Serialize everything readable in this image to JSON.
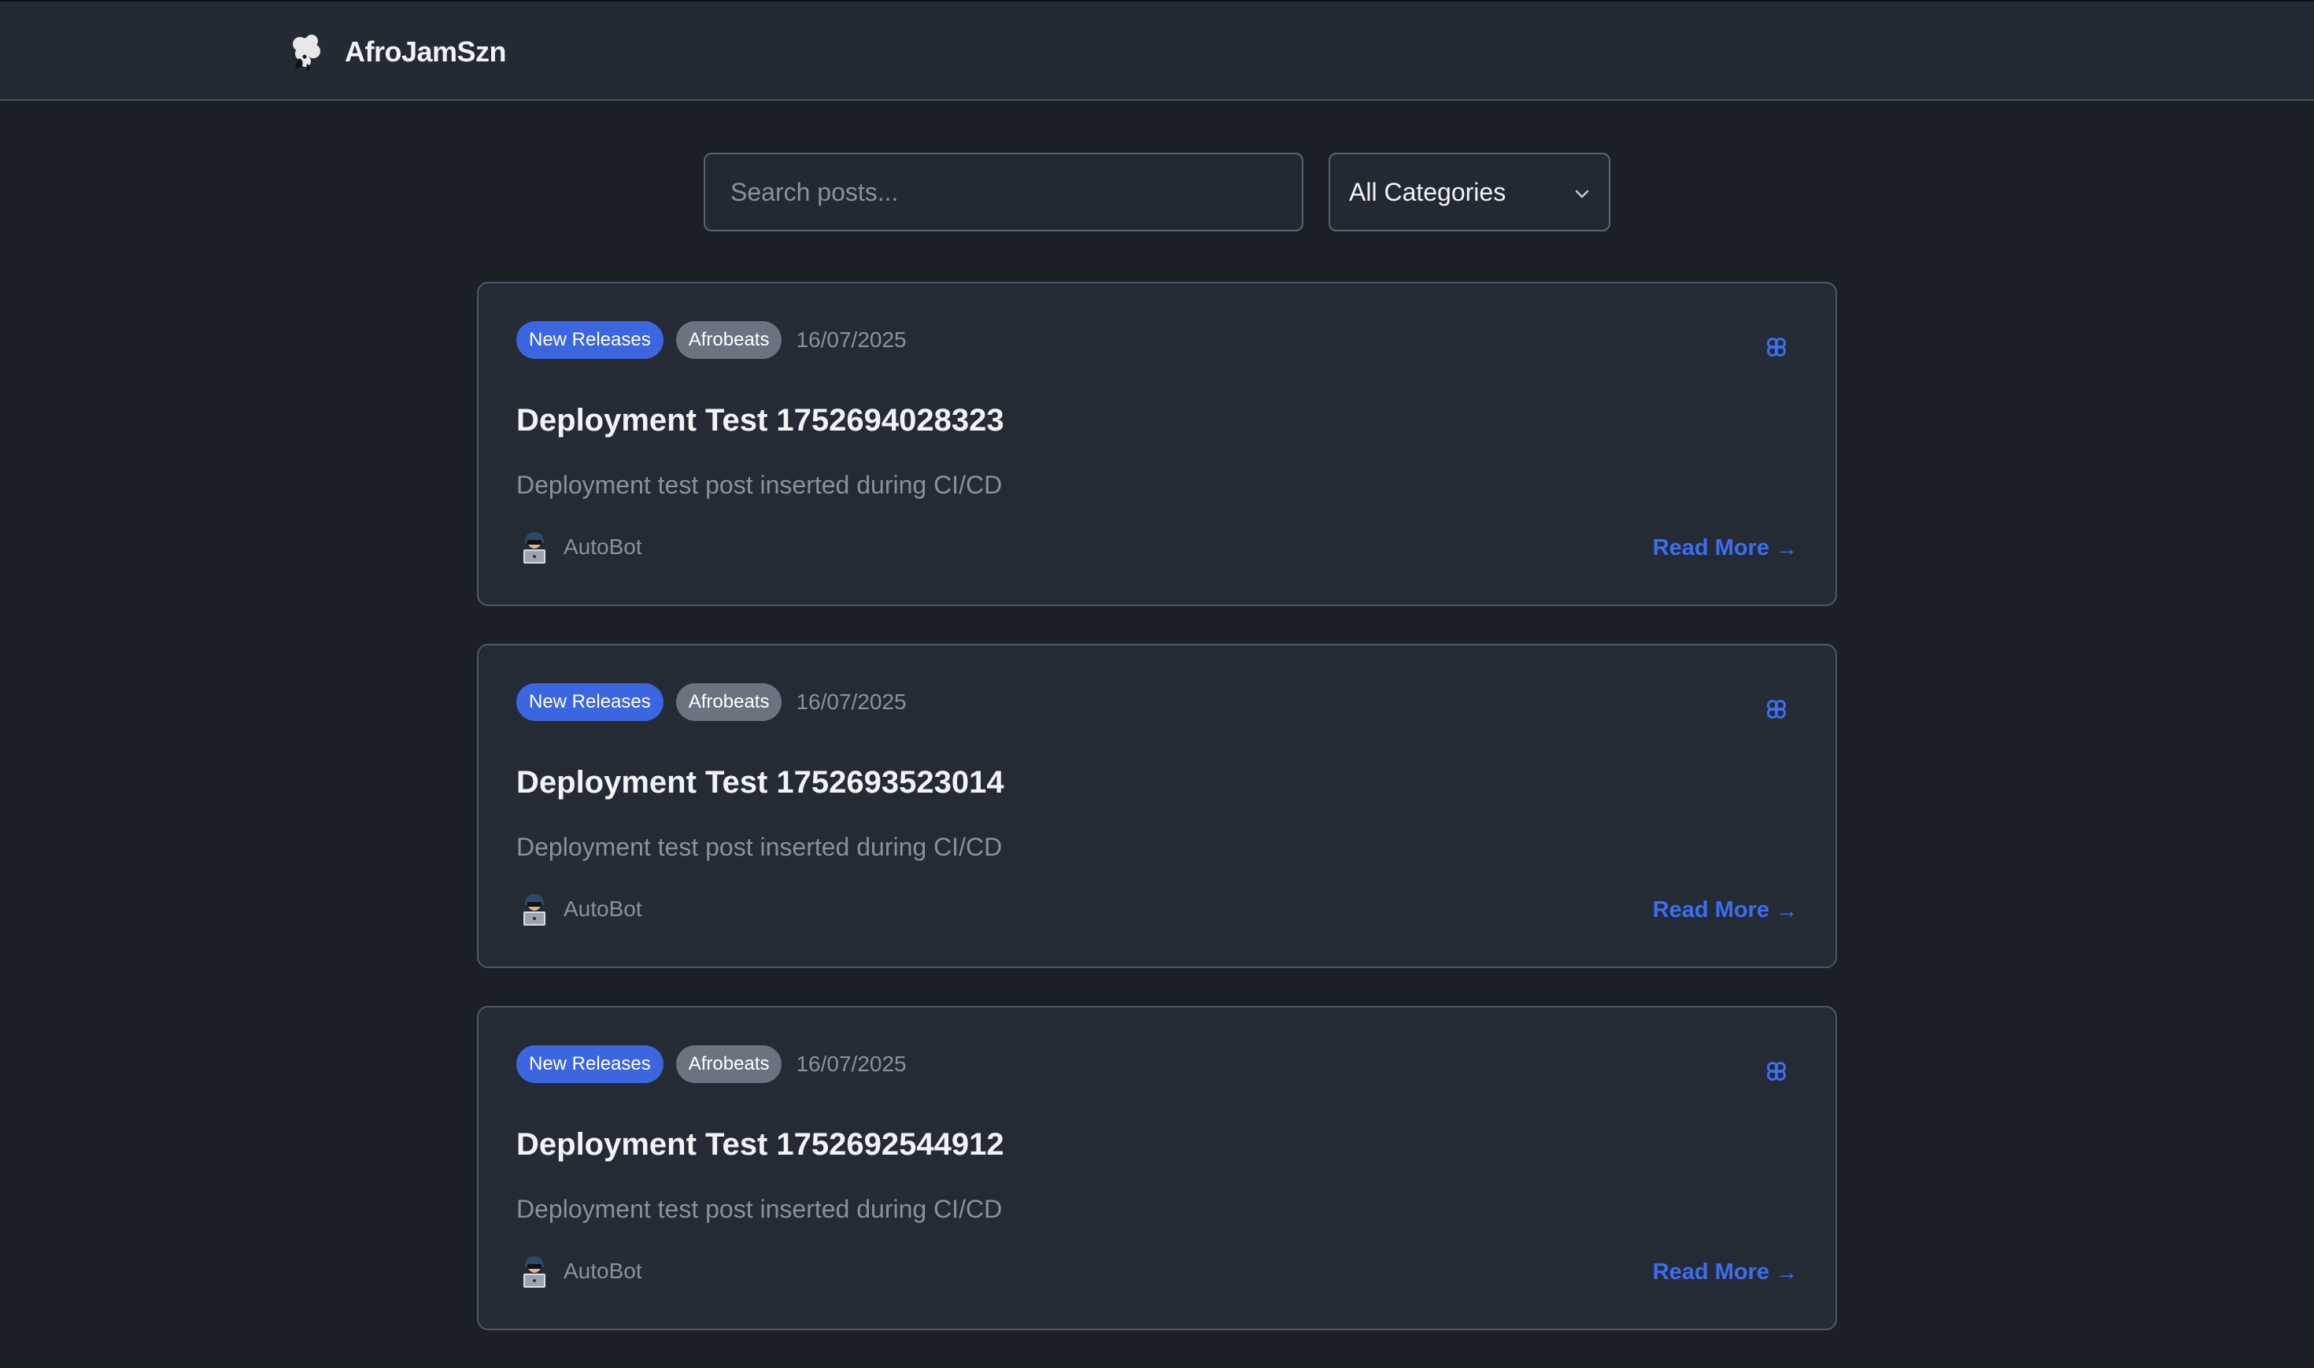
{
  "header": {
    "brand_name": "AfroJamSzn",
    "logo_icon": "afro-head-icon"
  },
  "filters": {
    "search_placeholder": "Search posts...",
    "category_selected": "All Categories"
  },
  "colors": {
    "accent": "#3d6df0",
    "badge_primary": "#3b66e0",
    "badge_secondary": "#6b7280",
    "background": "#1b1f26",
    "card": "#252b35"
  },
  "posts": [
    {
      "category": "New Releases",
      "tag": "Afrobeats",
      "date": "16/07/2025",
      "title": "Deployment Test 1752694028323",
      "excerpt": "Deployment test post inserted during CI/CD",
      "author": "AutoBot",
      "read_more": "Read More",
      "arrow": "→"
    },
    {
      "category": "New Releases",
      "tag": "Afrobeats",
      "date": "16/07/2025",
      "title": "Deployment Test 1752693523014",
      "excerpt": "Deployment test post inserted during CI/CD",
      "author": "AutoBot",
      "read_more": "Read More",
      "arrow": "→"
    },
    {
      "category": "New Releases",
      "tag": "Afrobeats",
      "date": "16/07/2025",
      "title": "Deployment Test 1752692544912",
      "excerpt": "Deployment test post inserted during CI/CD",
      "author": "AutoBot",
      "read_more": "Read More",
      "arrow": "→"
    }
  ]
}
